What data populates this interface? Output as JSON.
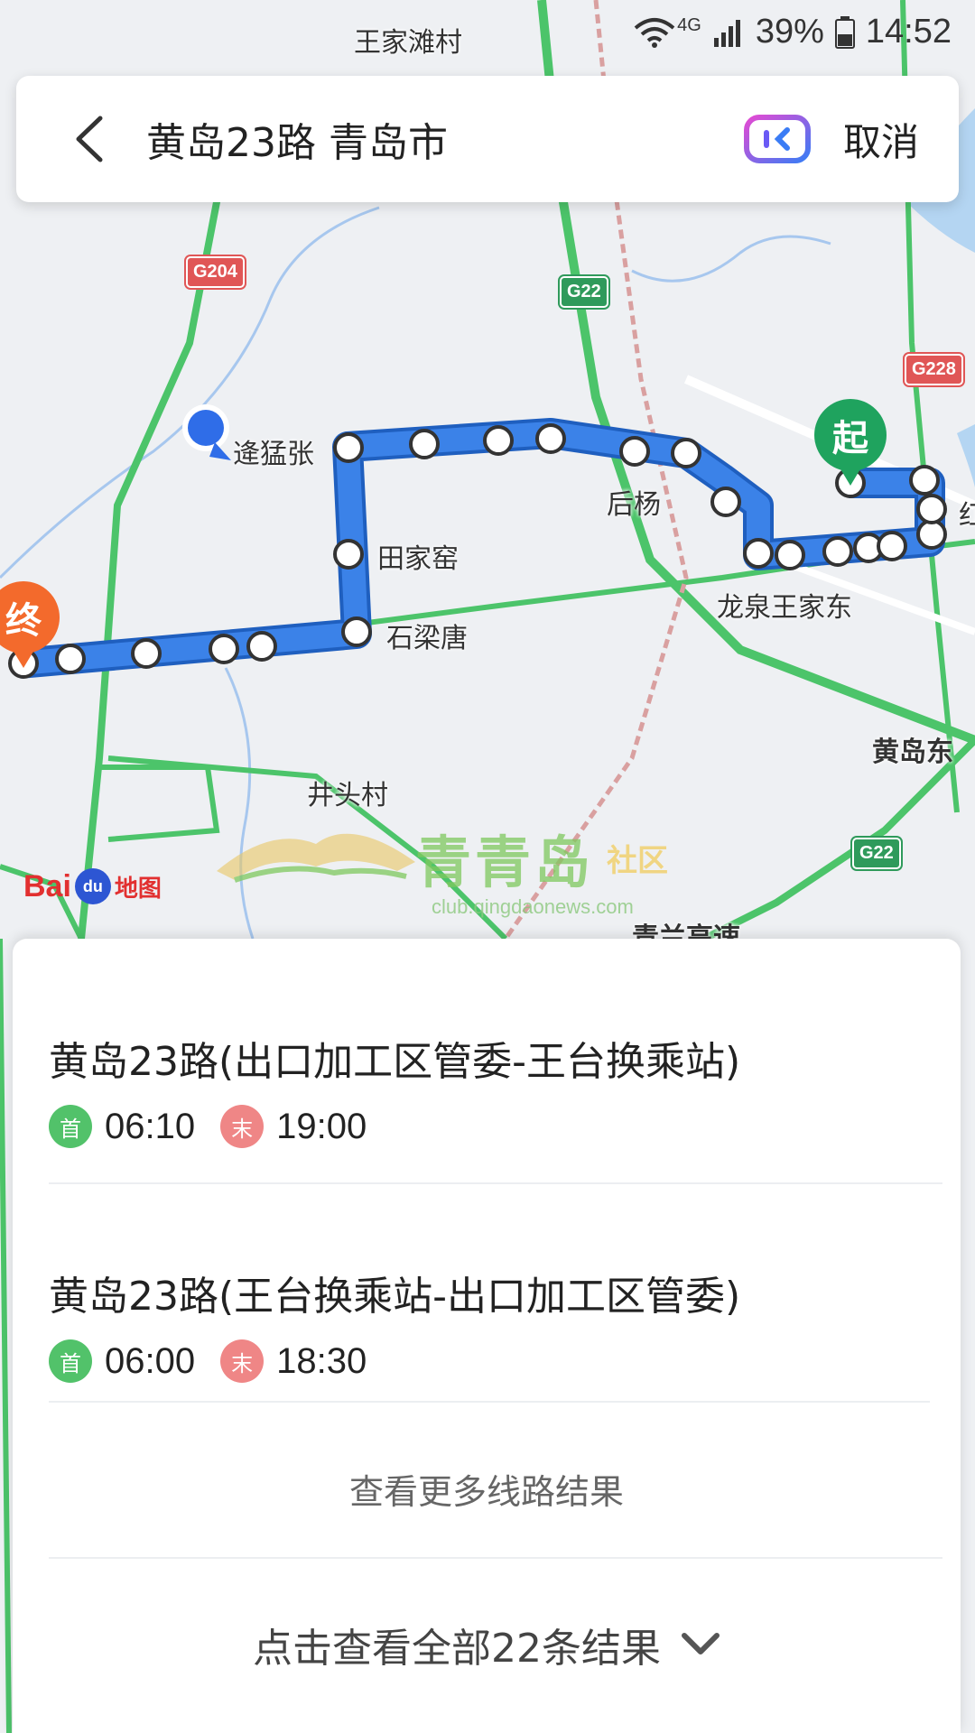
{
  "status_bar": {
    "network": "4G",
    "battery": "39%",
    "time": "14:52"
  },
  "search": {
    "query": "黄岛23路 青岛市",
    "cancel_label": "取消"
  },
  "map": {
    "labels": {
      "village_top": "王家滩村",
      "stop_kuimengzhang": "逄猛张",
      "stop_tianjiayao": "田家窑",
      "stop_shiliangtang": "石梁唐",
      "stop_houyang": "后杨",
      "stop_longquan": "龙泉王家东",
      "village_jingtou": "井头村",
      "district_huangdao_east": "黄岛东",
      "road_partial": "青兰高速",
      "edge_char": "红"
    },
    "roads": [
      "G204",
      "G22",
      "G228",
      "G22"
    ],
    "start_marker": "起",
    "end_marker": "终",
    "logo": {
      "bai": "Bai",
      "du": "du",
      "ditu": "地图"
    },
    "watermark": {
      "title": "青青岛",
      "sub": "社区",
      "url": "club.qingdaonews.com"
    }
  },
  "results": {
    "routes": [
      {
        "name": "黄岛23路(出口加工区管委-王台换乘站)",
        "first_label": "首",
        "first_time": "06:10",
        "last_label": "末",
        "last_time": "19:00"
      },
      {
        "name": "黄岛23路(王台换乘站-出口加工区管委)",
        "first_label": "首",
        "first_time": "06:00",
        "last_label": "末",
        "last_time": "18:30"
      }
    ],
    "more_label": "查看更多线路结果",
    "all_label": "点击查看全部22条结果"
  },
  "colors": {
    "route_line": "#3b82e8",
    "road_green": "#4cc46a",
    "accent_start": "#1fa35e",
    "accent_end": "#f36a2c"
  }
}
